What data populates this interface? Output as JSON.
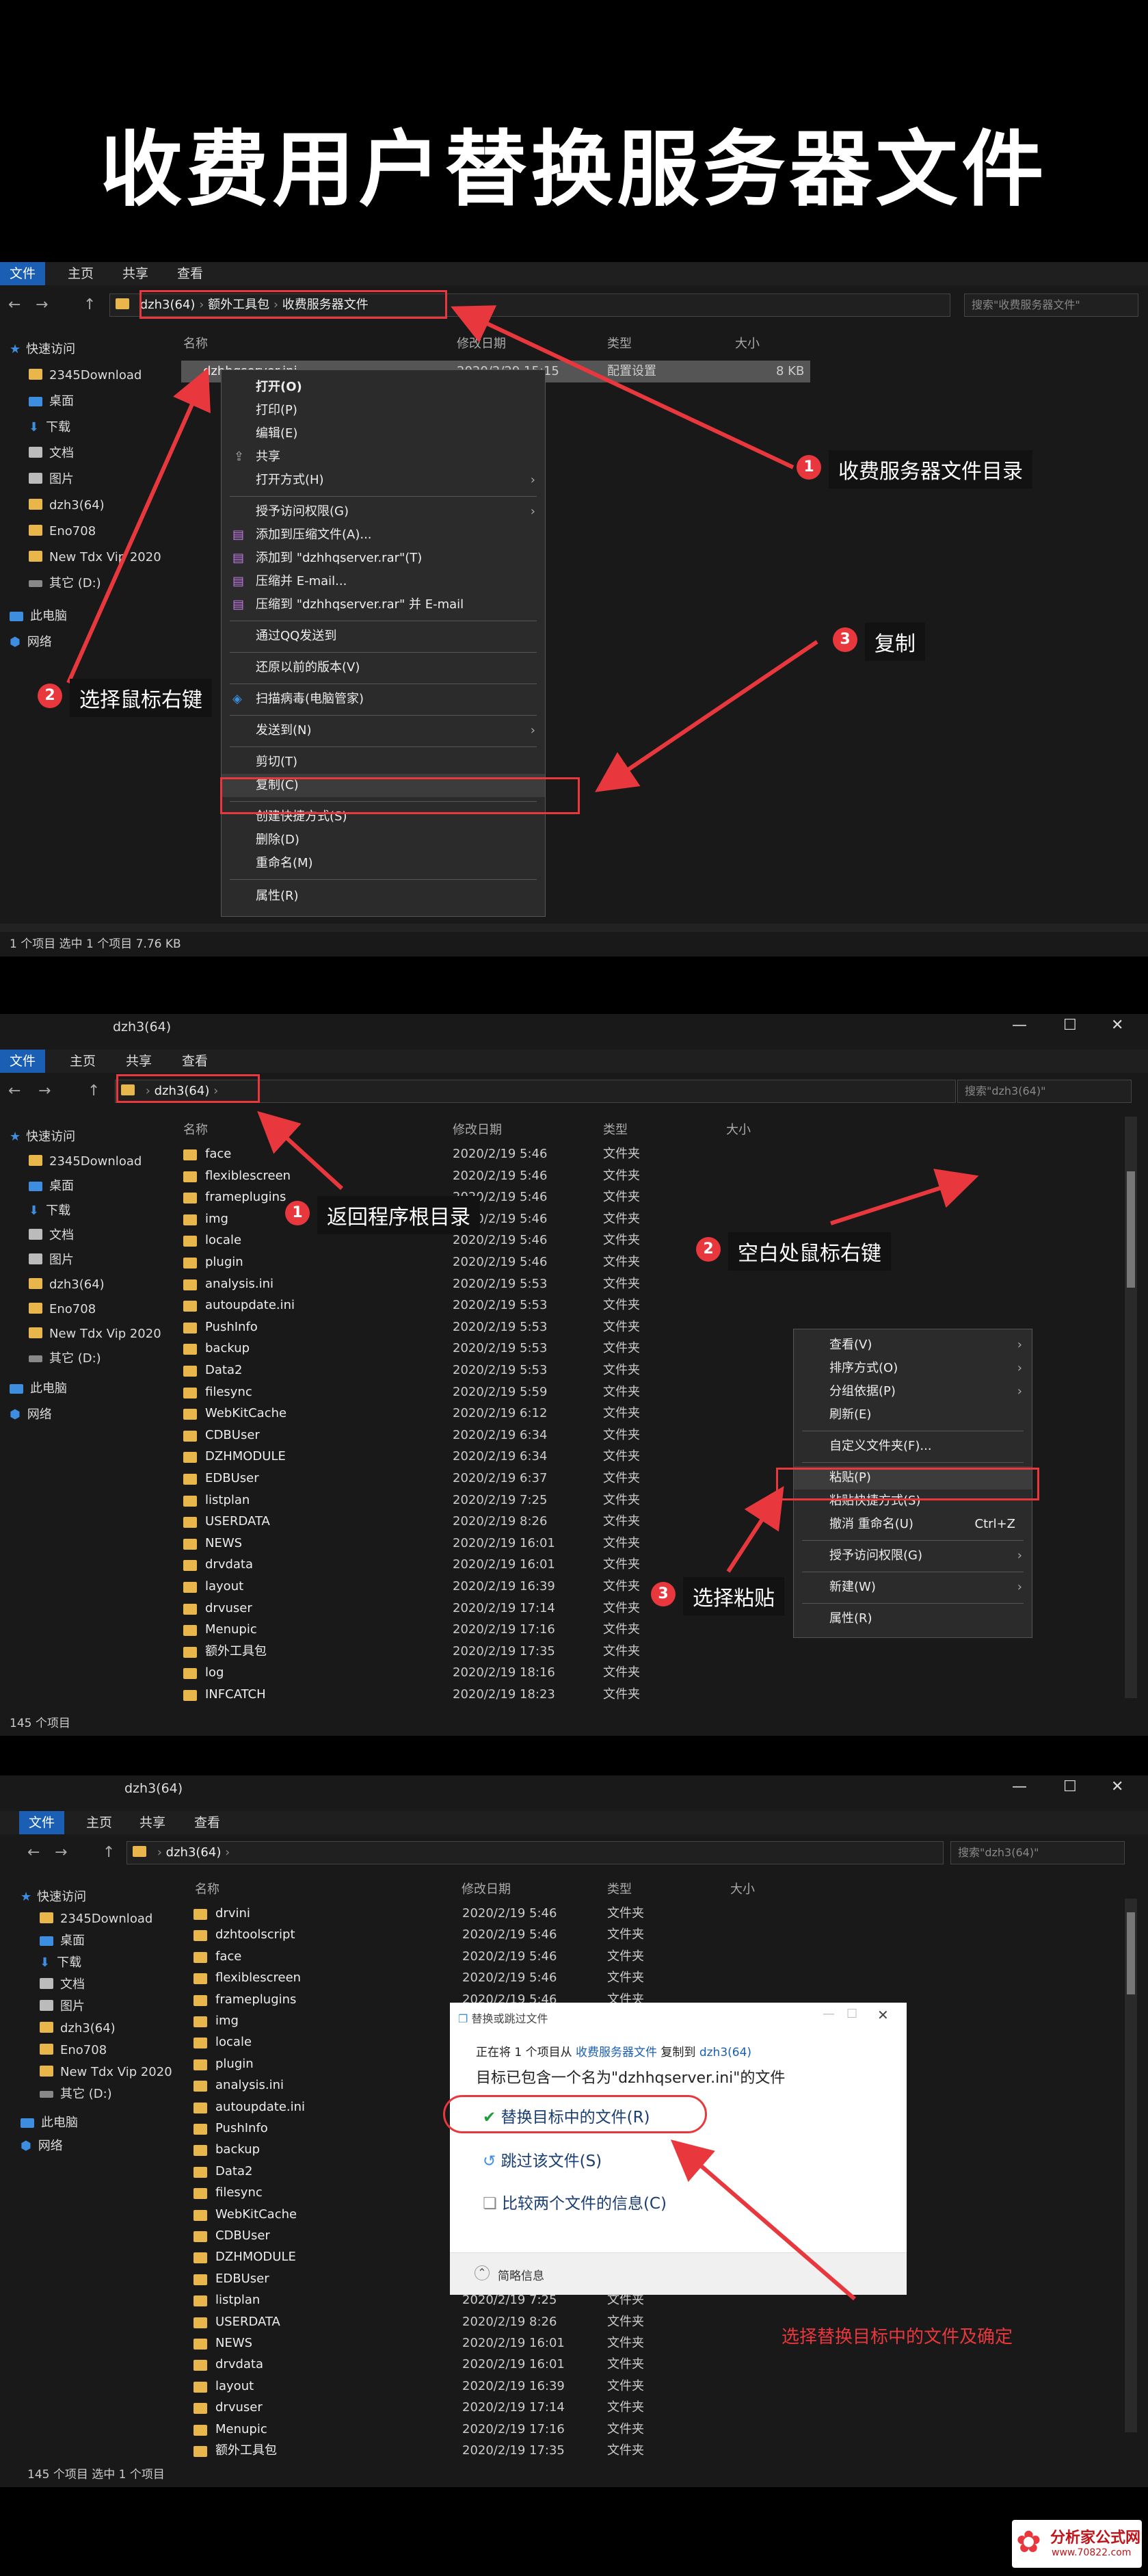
{
  "page_title": "收费用户替换服务器文件",
  "panel1": {
    "tabs": [
      "文件",
      "主页",
      "共享",
      "查看"
    ],
    "breadcrumb": [
      "dzh3(64)",
      "额外工具包",
      "收费服务器文件"
    ],
    "search_placeholder": "搜索\"收费服务器文件\"",
    "columns": [
      "名称",
      "修改日期",
      "类型",
      "大小"
    ],
    "file": {
      "name": "dzhhqserver.ini",
      "date": "2020/2/29 15:15",
      "type": "配置设置",
      "size": "8 KB"
    },
    "sidebar": [
      "快速访问",
      "2345Download",
      "桌面",
      "下载",
      "文档",
      "图片",
      "dzh3(64)",
      "Eno708",
      "New Tdx Vip 2020",
      "其它 (D:)",
      "此电脑",
      "网络"
    ],
    "menu": [
      "打开(O)",
      "打印(P)",
      "编辑(E)",
      "共享",
      "打开方式(H)",
      "授予访问权限(G)",
      "添加到压缩文件(A)...",
      "添加到 \"dzhhqserver.rar\"(T)",
      "压缩并 E-mail...",
      "压缩到 \"dzhhqserver.rar\" 并 E-mail",
      "通过QQ发送到",
      "还原以前的版本(V)",
      "扫描病毒(电脑管家)",
      "发送到(N)",
      "剪切(T)",
      "复制(C)",
      "创建快捷方式(S)",
      "删除(D)",
      "重命名(M)",
      "属性(R)"
    ],
    "status": "1 个项目   选中 1 个项目  7.76 KB",
    "annotations": [
      {
        "num": "1",
        "text": "收费服务器文件目录"
      },
      {
        "num": "2",
        "text": "选择鼠标右键"
      },
      {
        "num": "3",
        "text": "复制"
      }
    ]
  },
  "panel2": {
    "window_title": "dzh3(64)",
    "tabs": [
      "文件",
      "主页",
      "共享",
      "查看"
    ],
    "breadcrumb": [
      "dzh3(64)"
    ],
    "search_placeholder": "搜索\"dzh3(64)\"",
    "columns": [
      "名称",
      "修改日期",
      "类型",
      "大小"
    ],
    "rows": [
      [
        "face",
        "2020/2/19 5:46",
        "文件夹"
      ],
      [
        "flexiblescreen",
        "2020/2/19 5:46",
        "文件夹"
      ],
      [
        "frameplugins",
        "2020/2/19 5:46",
        "文件夹"
      ],
      [
        "img",
        "2020/2/19 5:46",
        "文件夹"
      ],
      [
        "locale",
        "2020/2/19 5:46",
        "文件夹"
      ],
      [
        "plugin",
        "2020/2/19 5:46",
        "文件夹"
      ],
      [
        "analysis.ini",
        "2020/2/19 5:53",
        "文件夹"
      ],
      [
        "autoupdate.ini",
        "2020/2/19 5:53",
        "文件夹"
      ],
      [
        "PushInfo",
        "2020/2/19 5:53",
        "文件夹"
      ],
      [
        "backup",
        "2020/2/19 5:53",
        "文件夹"
      ],
      [
        "Data2",
        "2020/2/19 5:53",
        "文件夹"
      ],
      [
        "filesync",
        "2020/2/19 5:59",
        "文件夹"
      ],
      [
        "WebKitCache",
        "2020/2/19 6:12",
        "文件夹"
      ],
      [
        "CDBUser",
        "2020/2/19 6:34",
        "文件夹"
      ],
      [
        "DZHMODULE",
        "2020/2/19 6:34",
        "文件夹"
      ],
      [
        "EDBUser",
        "2020/2/19 6:37",
        "文件夹"
      ],
      [
        "listplan",
        "2020/2/19 7:25",
        "文件夹"
      ],
      [
        "USERDATA",
        "2020/2/19 8:26",
        "文件夹"
      ],
      [
        "NEWS",
        "2020/2/19 16:01",
        "文件夹"
      ],
      [
        "drvdata",
        "2020/2/19 16:01",
        "文件夹"
      ],
      [
        "layout",
        "2020/2/19 16:39",
        "文件夹"
      ],
      [
        "drvuser",
        "2020/2/19 17:14",
        "文件夹"
      ],
      [
        "Menupic",
        "2020/2/19 17:16",
        "文件夹"
      ],
      [
        "额外工具包",
        "2020/2/19 17:35",
        "文件夹"
      ],
      [
        "log",
        "2020/2/19 18:16",
        "文件夹"
      ],
      [
        "INFCATCH",
        "2020/2/19 18:23",
        "文件夹"
      ]
    ],
    "sidebar": [
      "快速访问",
      "2345Download",
      "桌面",
      "下载",
      "文档",
      "图片",
      "dzh3(64)",
      "Eno708",
      "New Tdx Vip 2020",
      "其它 (D:)",
      "此电脑",
      "网络"
    ],
    "menu": [
      "查看(V)",
      "排序方式(O)",
      "分组依据(P)",
      "刷新(E)",
      "自定义文件夹(F)...",
      "粘贴(P)",
      "粘贴快捷方式(S)",
      "撤消 重命名(U)",
      "授予访问权限(G)",
      "新建(W)",
      "属性(R)"
    ],
    "undo_shortcut": "Ctrl+Z",
    "status": "145 个项目",
    "annotations": [
      {
        "num": "1",
        "text": "返回程序根目录"
      },
      {
        "num": "2",
        "text": "空白处鼠标右键"
      },
      {
        "num": "3",
        "text": "选择粘贴"
      }
    ]
  },
  "panel3": {
    "window_title": "dzh3(64)",
    "tabs": [
      "文件",
      "主页",
      "共享",
      "查看"
    ],
    "breadcrumb": [
      "dzh3(64)"
    ],
    "search_placeholder": "搜索\"dzh3(64)\"",
    "columns": [
      "名称",
      "修改日期",
      "类型",
      "大小"
    ],
    "rows": [
      [
        "drvini",
        "2020/2/19 5:46",
        "文件夹"
      ],
      [
        "dzhtoolscript",
        "2020/2/19 5:46",
        "文件夹"
      ],
      [
        "face",
        "2020/2/19 5:46",
        "文件夹"
      ],
      [
        "flexiblescreen",
        "2020/2/19 5:46",
        "文件夹"
      ],
      [
        "frameplugins",
        "2020/2/19 5:46",
        "文件夹"
      ],
      [
        "img",
        "",
        ""
      ],
      [
        "locale",
        "",
        ""
      ],
      [
        "plugin",
        "",
        ""
      ],
      [
        "analysis.ini",
        "",
        ""
      ],
      [
        "autoupdate.ini",
        "",
        ""
      ],
      [
        "PushInfo",
        "",
        ""
      ],
      [
        "backup",
        "",
        ""
      ],
      [
        "Data2",
        "",
        ""
      ],
      [
        "filesync",
        "",
        ""
      ],
      [
        "WebKitCache",
        "",
        ""
      ],
      [
        "CDBUser",
        "",
        ""
      ],
      [
        "DZHMODULE",
        "",
        ""
      ],
      [
        "EDBUser",
        "",
        ""
      ],
      [
        "listplan",
        "2020/2/19 7:25",
        "文件夹"
      ],
      [
        "USERDATA",
        "2020/2/19 8:26",
        "文件夹"
      ],
      [
        "NEWS",
        "2020/2/19 16:01",
        "文件夹"
      ],
      [
        "drvdata",
        "2020/2/19 16:01",
        "文件夹"
      ],
      [
        "layout",
        "2020/2/19 16:39",
        "文件夹"
      ],
      [
        "drvuser",
        "2020/2/19 17:14",
        "文件夹"
      ],
      [
        "Menupic",
        "2020/2/19 17:16",
        "文件夹"
      ],
      [
        "额外工具包",
        "2020/2/19 17:35",
        "文件夹"
      ]
    ],
    "sidebar": [
      "快速访问",
      "2345Download",
      "桌面",
      "下载",
      "文档",
      "图片",
      "dzh3(64)",
      "Eno708",
      "New Tdx Vip 2020",
      "其它 (D:)",
      "此电脑",
      "网络"
    ],
    "dialog": {
      "title": "替换或跳过文件",
      "line1_pre": "正在将 1 个项目从 ",
      "line1_src": "收费服务器文件",
      "line1_mid": " 复制到 ",
      "line1_dst": "dzh3(64)",
      "line2": "目标已包含一个名为\"dzhhqserver.ini\"的文件",
      "opt_replace": "替换目标中的文件(R)",
      "opt_skip": "跳过该文件(S)",
      "opt_compare": "比较两个文件的信息(C)",
      "details": "简略信息"
    },
    "status": "145 个项目   选中 1 个项目",
    "annotation": "选择替换目标中的文件及确定"
  },
  "watermark": {
    "main": "分析家公式网",
    "url": "www.70822.com"
  }
}
